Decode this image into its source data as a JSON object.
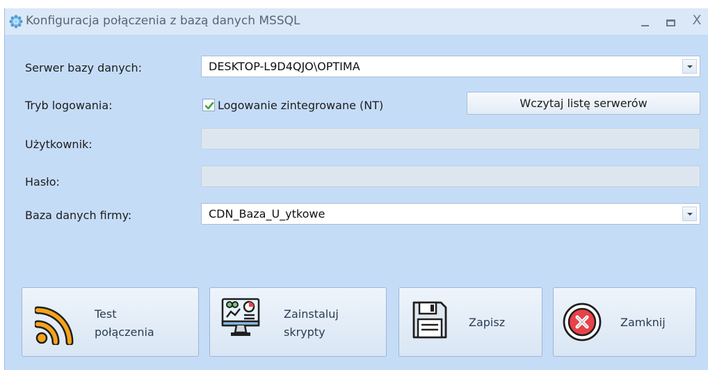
{
  "window": {
    "title": "Konfiguracja połączenia z bazą danych MSSQL",
    "minimize_symbol": "_",
    "close_symbol": "X"
  },
  "form": {
    "server_label": "Serwer bazy danych:",
    "server_value": "DESKTOP-L9D4QJO\\OPTIMA",
    "login_mode_label": "Tryb logowania:",
    "integrated_checkbox_label": "Logowanie zintegrowane (NT)",
    "integrated_checked": true,
    "load_servers_label": "Wczytaj listę serwerów",
    "user_label": "Użytkownik:",
    "user_value": "",
    "password_label": "Hasło:",
    "password_value": "",
    "company_db_label": "Baza danych firmy:",
    "company_db_value": "CDN_Baza_U_ytkowe"
  },
  "buttons": {
    "test_line1": "Test",
    "test_line2": "połączenia",
    "install_line1": "Zainstaluj",
    "install_line2": "skrypty",
    "save": "Zapisz",
    "close": "Zamknij"
  },
  "icons": {
    "app": "gear-icon",
    "test": "wifi-signal-icon",
    "install": "monitor-chart-icon",
    "save": "floppy-disk-icon",
    "close": "close-circle-icon"
  },
  "colors": {
    "window_bg": "#c5dcf7",
    "check_green": "#3aa63a",
    "wifi_orange": "#f5a31b",
    "close_red": "#e8424a"
  }
}
